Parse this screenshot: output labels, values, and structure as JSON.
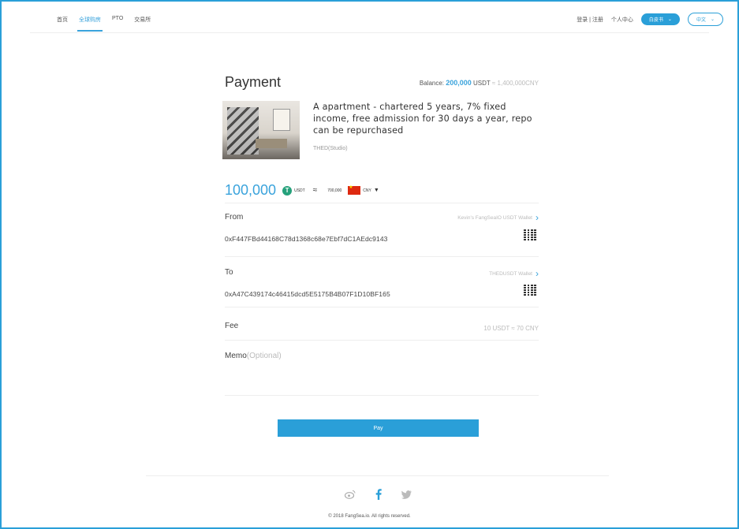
{
  "nav": {
    "items": [
      {
        "label": "首页",
        "active": false
      },
      {
        "label": "全球购房",
        "active": true
      },
      {
        "label": "PTO",
        "active": false
      },
      {
        "label": "交易所",
        "active": false
      }
    ],
    "login_register": "登录 | 注册",
    "personal_center": "个人中心",
    "currency_dropdown": "白皮书",
    "language_dropdown": "中文"
  },
  "payment": {
    "title": "Payment",
    "balance_label": "Balance:",
    "balance_amount": "200,000",
    "balance_unit": "USDT",
    "balance_approx": "≈ 1,400,000CNY"
  },
  "listing": {
    "title": "A apartment - chartered 5 years, 7% fixed income, free admission for 30 days a year, repo can be repurchased",
    "subtitle": "THED(Studio)"
  },
  "amount": {
    "value": "100,000",
    "coin_symbol": "T",
    "coin_unit": "USDT",
    "approx_symbol": "≈",
    "converted": "700,000",
    "currency": "CNY"
  },
  "from": {
    "label": "From",
    "wallet": "Kevin's FangSeaIO USDT Wallet",
    "address": "0xF447FBd44168C78d1368c68e7Ebf7dC1AEdc9143"
  },
  "to": {
    "label": "To",
    "wallet": "THEDUSDT Wallet",
    "address": "0xA47C439174c46415dcd5E5175B4B07F1D10BF165"
  },
  "fee": {
    "label": "Fee",
    "value": "10 USDT ≈ 70 CNY"
  },
  "memo": {
    "label": "Memo",
    "optional": "(Optional)"
  },
  "pay_button": "Pay",
  "footer": {
    "copyright": "© 2018 FangSea.io. All rights reserved."
  },
  "colors": {
    "accent": "#2a9fd8",
    "tether": "#26a17b"
  }
}
